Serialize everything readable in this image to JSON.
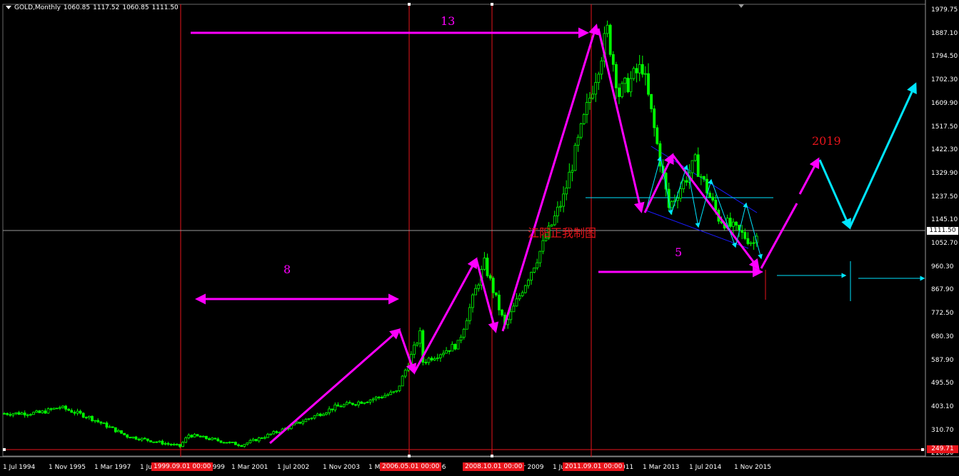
{
  "header": {
    "symbol": "GOLD,Monthly",
    "open": "1060.85",
    "high": "1117.52",
    "low": "1060.85",
    "close": "1111.50"
  },
  "price_labels": [
    "1979.75",
    "1887.10",
    "1794.50",
    "1702.30",
    "1609.90",
    "1517.50",
    "1422.30",
    "1329.90",
    "1237.50",
    "1145.10",
    "1052.70",
    "960.30",
    "867.90",
    "772.50",
    "680.30",
    "587.90",
    "495.50",
    "403.10",
    "310.70",
    "218.30"
  ],
  "current_price": "1111.50",
  "bottom_price": "249.71",
  "time_labels": [
    "1 Jul 1994",
    "1 Nov 1995",
    "1 Mar 1997",
    "1 Ju",
    "1999",
    "1 Mar 2001",
    "1 Jul 2002",
    "1 Nov 2003",
    "1 M",
    "06",
    "r 2009",
    "1 Ju",
    "011",
    "1 Mar 2013",
    "1 Jul 2014",
    "1 Nov 2015"
  ],
  "time_tags": [
    "1999.09.01 00:00",
    "2006.05.01 00:00",
    "2008.10.01 00:00",
    "2011.09.01 00:00"
  ],
  "annotations": {
    "count_top": "13",
    "count_left": "8",
    "count_right": "5",
    "year": "2019",
    "watermark": "江阳正我制图"
  },
  "colors": {
    "background": "#000000",
    "candle": "#00ff00",
    "magenta": "#ff00ff",
    "cyan": "#00e5ff",
    "red_line": "#e8141b",
    "axis_text": "#ffffff",
    "channel": "#1a1aff"
  },
  "chart_data": {
    "type": "candlestick",
    "symbol": "GOLD",
    "timeframe": "Monthly",
    "ylim": [
      218.3,
      1979.75
    ],
    "x_range": [
      "1994-07",
      "2015-12"
    ],
    "last_bar": {
      "open": 1060.85,
      "high": 1117.52,
      "low": 1060.85,
      "close": 1111.5
    },
    "yearly_path": [
      {
        "date": "1994-07",
        "price": 385
      },
      {
        "date": "1995-07",
        "price": 387
      },
      {
        "date": "1996-02",
        "price": 410
      },
      {
        "date": "1996-12",
        "price": 370
      },
      {
        "date": "1997-07",
        "price": 330
      },
      {
        "date": "1998-01",
        "price": 295
      },
      {
        "date": "1999-07",
        "price": 255
      },
      {
        "date": "1999-10",
        "price": 300
      },
      {
        "date": "2001-04",
        "price": 260
      },
      {
        "date": "2002-06",
        "price": 320
      },
      {
        "date": "2003-12",
        "price": 410
      },
      {
        "date": "2004-12",
        "price": 440
      },
      {
        "date": "2005-09",
        "price": 470
      },
      {
        "date": "2006-05",
        "price": 700
      },
      {
        "date": "2006-06",
        "price": 590
      },
      {
        "date": "2007-06",
        "price": 660
      },
      {
        "date": "2008-03",
        "price": 980
      },
      {
        "date": "2008-10",
        "price": 730
      },
      {
        "date": "2009-09",
        "price": 1000
      },
      {
        "date": "2010-06",
        "price": 1240
      },
      {
        "date": "2011-09",
        "price": 1900
      },
      {
        "date": "2012-01",
        "price": 1650
      },
      {
        "date": "2012-09",
        "price": 1760
      },
      {
        "date": "2013-06",
        "price": 1200
      },
      {
        "date": "2014-03",
        "price": 1380
      },
      {
        "date": "2014-11",
        "price": 1160
      },
      {
        "date": "2015-11",
        "price": 1060
      },
      {
        "date": "2015-12",
        "price": 1111.5
      }
    ]
  }
}
